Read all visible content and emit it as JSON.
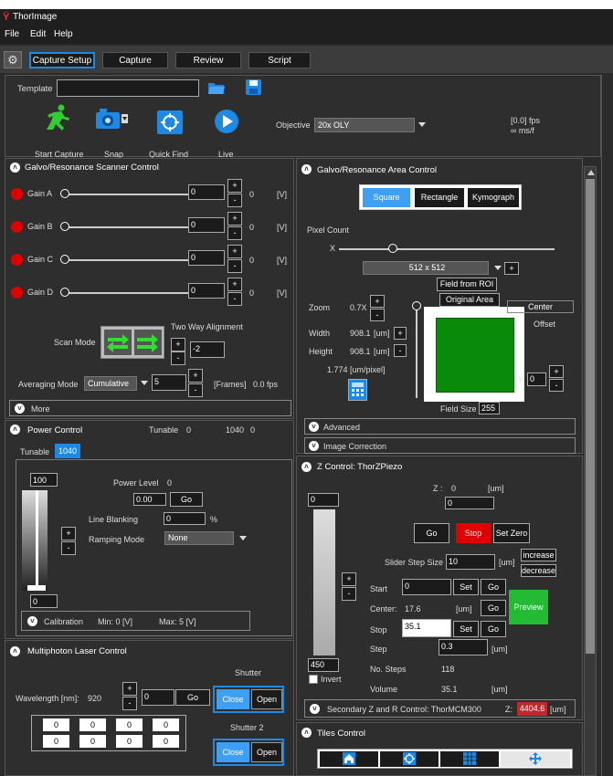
{
  "window": {
    "title": "ThorImage"
  },
  "menu": [
    "File",
    "Edit",
    "Help"
  ],
  "tabs": [
    "Capture Setup",
    "Capture",
    "Review",
    "Script"
  ],
  "toolbar": {
    "template_label": "Template",
    "template_value": "",
    "buttons": [
      "Start Capture",
      "Snap",
      "Quick Find",
      "Live"
    ],
    "objective_label": "Objective",
    "objective_value": "20x OLY",
    "fps": "[0.0] fps",
    "msf": "∞ ms/f"
  },
  "galvo": {
    "title": "Galvo/Resonance Scanner Control",
    "gains": [
      {
        "label": "Gain A",
        "value": "0",
        "readout": "0",
        "unit": "[V]"
      },
      {
        "label": "Gain B",
        "value": "0",
        "readout": "0",
        "unit": "[V]"
      },
      {
        "label": "Gain C",
        "value": "0",
        "readout": "0",
        "unit": "[V]"
      },
      {
        "label": "Gain D",
        "value": "0",
        "readout": "0",
        "unit": "[V]"
      }
    ],
    "scan_mode_label": "Scan Mode",
    "two_way_label": "Two Way Alignment",
    "two_way_value": "-2",
    "averaging_label": "Averaging Mode",
    "averaging_value": "Cumulative",
    "frames_value": "5",
    "frames_unit": "[Frames]",
    "fps": "0.0 fps",
    "more_label": "More"
  },
  "power": {
    "title": "Power Control",
    "tunable_header": "Tunable",
    "tunable_header_value": "0",
    "tunable_header_value2": "1040",
    "tunable_header_value3": "0",
    "tab_label": "Tunable",
    "tab_value": "1040",
    "slider_top": "100",
    "slider_bottom": "0",
    "power_level_label": "Power Level",
    "power_level_value": "0",
    "power_input": "0.00",
    "go": "Go",
    "line_blanking_label": "Line Blanking",
    "line_blanking_value": "0",
    "percent": "%",
    "ramping_label": "Ramping Mode",
    "ramping_value": "None",
    "calibration_label": "Calibration",
    "calib_min": "Min:  0  [V]",
    "calib_max": "Max:  5  [V]"
  },
  "laser": {
    "title": "Multiphoton Laser Control",
    "wavelength_label": "Wavelength [nm]:",
    "wavelength_value": "920",
    "wavelength_input": "0",
    "go": "Go",
    "shutter_label": "Shutter",
    "shutter2_label": "Shutter 2",
    "close": "Close",
    "open": "Open",
    "grid": [
      "0",
      "0",
      "0",
      "0",
      "0",
      "0",
      "0",
      "0"
    ]
  },
  "area": {
    "title": "Galvo/Resonance Area Control",
    "modes": [
      "Square",
      "Rectangle",
      "Kymograph"
    ],
    "pixel_count_label": "Pixel Count",
    "x_label": "X",
    "pixel_value": "512 x 512",
    "field_from_roi": "Field from ROI",
    "original_area": "Original Area",
    "zoom_label": "Zoom",
    "zoom_value": "0.7X",
    "width_label": "Width",
    "width_value": "908.1",
    "height_label": "Height",
    "height_value": "908.1",
    "um": "[um]",
    "pixel_size": "1.774  [um/pixel]",
    "center": "Center",
    "offset": "Offset",
    "y_label": "Y",
    "y_value": "0",
    "field_size_label": "Field Size",
    "field_size_value": "255",
    "advanced": "Advanced",
    "image_correction": "Image Correction"
  },
  "z": {
    "title": "Z Control:  ThorZPiezo",
    "z_label": "Z :",
    "z_value": "0",
    "z_unit": "[um]",
    "z_input": "0",
    "slider_top": "0",
    "slider_bottom": "450",
    "invert": "Invert",
    "go": "Go",
    "stop": "Stop",
    "set_zero": "Set Zero",
    "step_size_label": "Slider Step Size",
    "step_size_value": "10",
    "increase": "increase",
    "decrease": "decrease",
    "start_label": "Start",
    "start_value": "0",
    "set": "Set",
    "center_label": "Center:",
    "center_value": "17.6",
    "stop_label": "Stop",
    "stop_value": "35.1",
    "step_label": "Step",
    "step_value": "0.3",
    "steps_label": "No. Steps",
    "steps_value": "118",
    "volume_label": "Volume",
    "volume_value": "35.1",
    "preview": "Preview",
    "secondary_label": "Secondary Z and R Control:  ThorMCM300",
    "secondary_z_label": "Z:",
    "secondary_z_value": "4404.6"
  },
  "tiles": {
    "title": "Tiles Control"
  },
  "colors": {
    "accent": "#1e88e5",
    "stop": "#e00000",
    "preview": "#22bb33",
    "field": "#0a8a0a",
    "secondary_z": "#c0282d"
  }
}
